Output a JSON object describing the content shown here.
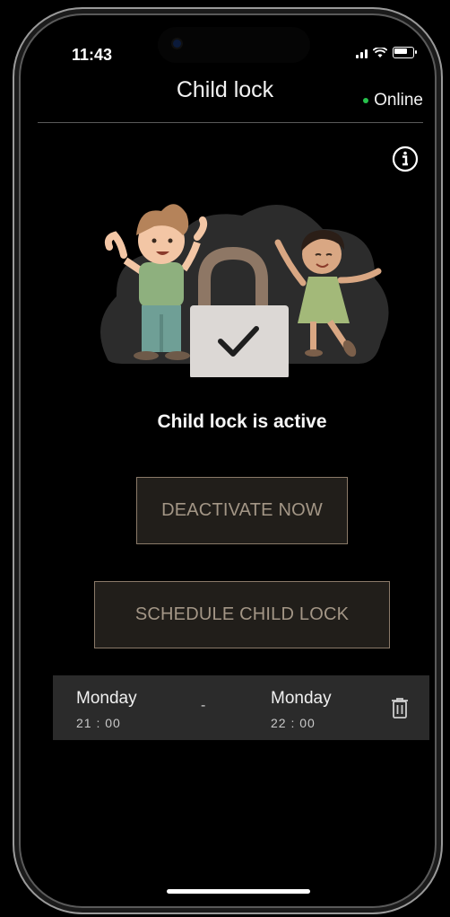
{
  "status_bar": {
    "time": "11:43"
  },
  "header": {
    "title": "Child lock",
    "status": "Online"
  },
  "main": {
    "status_message": "Child lock is active",
    "deactivate_label": "DEACTIVATE NOW",
    "schedule_label": "SCHEDULE CHILD LOCK"
  },
  "schedule": {
    "start_day": "Monday",
    "start_time": "21 : 00",
    "separator": "-",
    "end_day": "Monday",
    "end_time": "22 : 00"
  },
  "icons": [
    "info-icon",
    "trash-icon",
    "lock-check-icon"
  ],
  "colors": {
    "accent_border": "#8a7a69",
    "button_text": "#a39686",
    "online": "#27c24c"
  }
}
